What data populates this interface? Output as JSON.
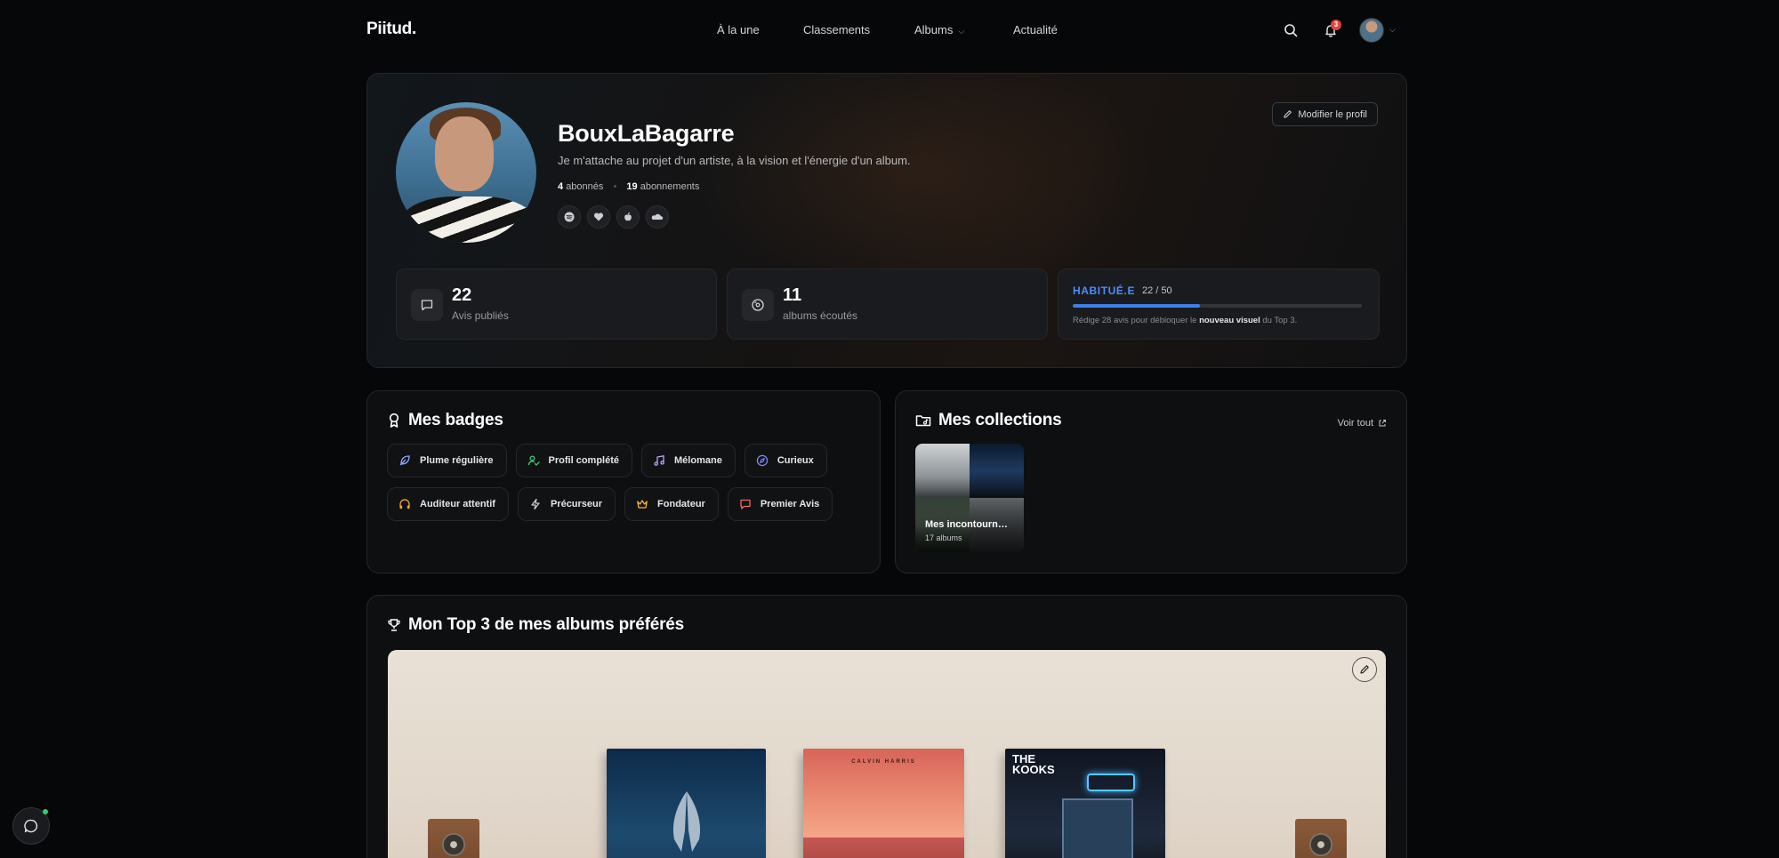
{
  "nav": {
    "logo": "Piitud.",
    "links": [
      {
        "label": "À la une"
      },
      {
        "label": "Classements"
      },
      {
        "label": "Albums",
        "has_dropdown": true
      },
      {
        "label": "Actualité"
      }
    ],
    "notification_count": "3",
    "icons": {
      "search": "search-icon",
      "notifications": "bell-icon",
      "account_menu": "chevron-down-icon"
    }
  },
  "profile": {
    "username": "BouxLaBagarre",
    "bio": "Je m'attache au projet d'un artiste, à la vision et l'énergie d'un album.",
    "followers_count": "4",
    "followers_label": "abonnés",
    "following_count": "19",
    "following_label": "abonnements",
    "socials": [
      "spotify-icon",
      "deezer-icon",
      "apple-music-icon",
      "soundcloud-icon"
    ],
    "edit_label": "Modifier le profil",
    "stats": [
      {
        "value": "22",
        "label": "Avis publiés",
        "icon": "comment-icon"
      },
      {
        "value": "11",
        "label": "albums écoutés",
        "icon": "vinyl-icon"
      }
    ],
    "level": {
      "name": "HABITUÉ.E",
      "progress_text": "22 / 50",
      "progress_fraction": 0.44,
      "hint_prefix": "Rédige 28 avis pour débloquer le",
      "hint_bold": "nouveau visuel",
      "hint_suffix": "du Top 3."
    }
  },
  "badges": {
    "title": "Mes badges",
    "items": [
      {
        "label": "Plume régulière",
        "icon": "feather-icon",
        "color": "#8fa9ff"
      },
      {
        "label": "Profil complété",
        "icon": "user-check-icon",
        "color": "#3fcf72"
      },
      {
        "label": "Mélomane",
        "icon": "music-note-icon",
        "color": "#b9a2ff"
      },
      {
        "label": "Curieux",
        "icon": "compass-icon",
        "color": "#7f86ff"
      },
      {
        "label": "Auditeur attentif",
        "icon": "headphones-icon",
        "color": "#f4a742"
      },
      {
        "label": "Précurseur",
        "icon": "lightning-icon",
        "color": "#c8c8cc"
      },
      {
        "label": "Fondateur",
        "icon": "crown-icon",
        "color": "#f2b640"
      },
      {
        "label": "Premier Avis",
        "icon": "message-icon",
        "color": "#f06a6a"
      }
    ]
  },
  "collections": {
    "title": "Mes collections",
    "see_all": "Voir tout",
    "items": [
      {
        "name": "Mes incontourn…",
        "count": "17 albums"
      }
    ]
  },
  "top3": {
    "title": "Mon Top 3 de mes albums préférés",
    "albums": [
      {
        "cover_text": ""
      },
      {
        "cover_text": "CALVIN HARRIS"
      },
      {
        "cover_text": "THE\nKOOKS"
      }
    ]
  },
  "colors": {
    "accent": "#3f7fec",
    "level": "#4b8dff",
    "notification": "#e0443b",
    "online": "#2fd06b"
  }
}
